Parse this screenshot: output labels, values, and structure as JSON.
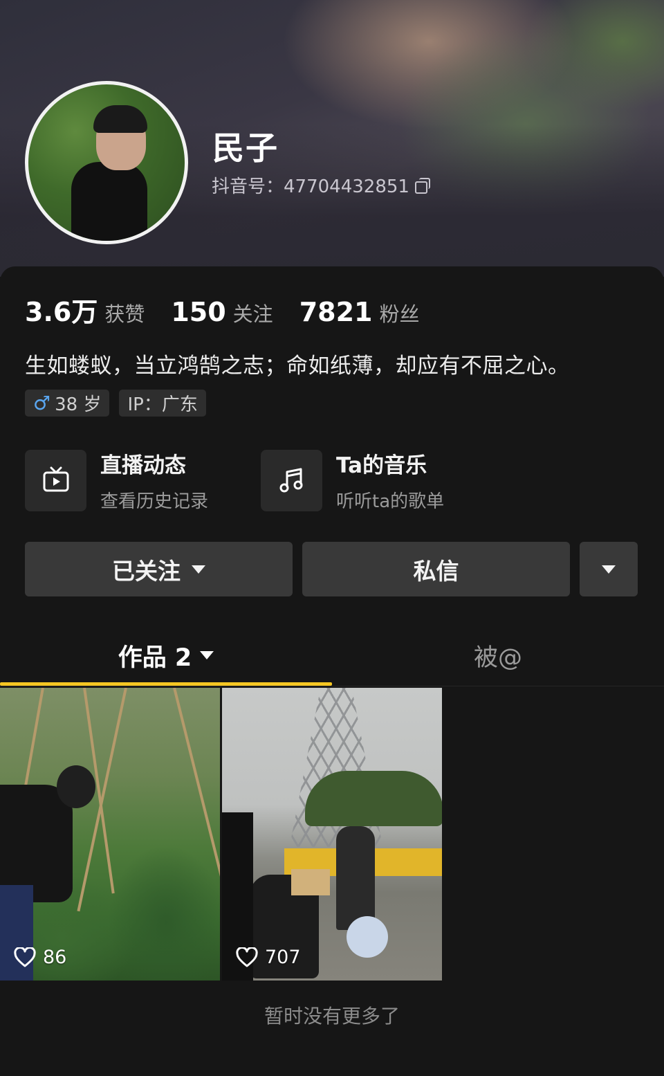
{
  "profile": {
    "name": "民子",
    "douyin_id": "抖音号：47704432851",
    "bio": "生如蝼蚁，当立鸿鹄之志；命如纸薄，却应有不屈之心。"
  },
  "stats": [
    {
      "value": "3.6万",
      "label": "获赞"
    },
    {
      "value": "150",
      "label": "关注"
    },
    {
      "value": "7821",
      "label": "粉丝"
    }
  ],
  "tags": {
    "age": "38 岁",
    "ip": "IP：广东"
  },
  "features": [
    {
      "title": "直播动态",
      "subtitle": "查看历史记录",
      "icon": "tv-icon"
    },
    {
      "title": "Ta的音乐",
      "subtitle": "听听ta的歌单",
      "icon": "music-note-icon"
    }
  ],
  "actions": {
    "follow": "已关注",
    "message": "私信"
  },
  "tabs": {
    "works": "作品 2",
    "mentioned": "被@"
  },
  "videos": [
    {
      "likes": "86"
    },
    {
      "likes": "707"
    }
  ],
  "end_note": "暂时没有更多了",
  "colors": {
    "accent": "#f5c623",
    "background": "#161616",
    "button": "#393939",
    "male": "#5aa6f0"
  }
}
